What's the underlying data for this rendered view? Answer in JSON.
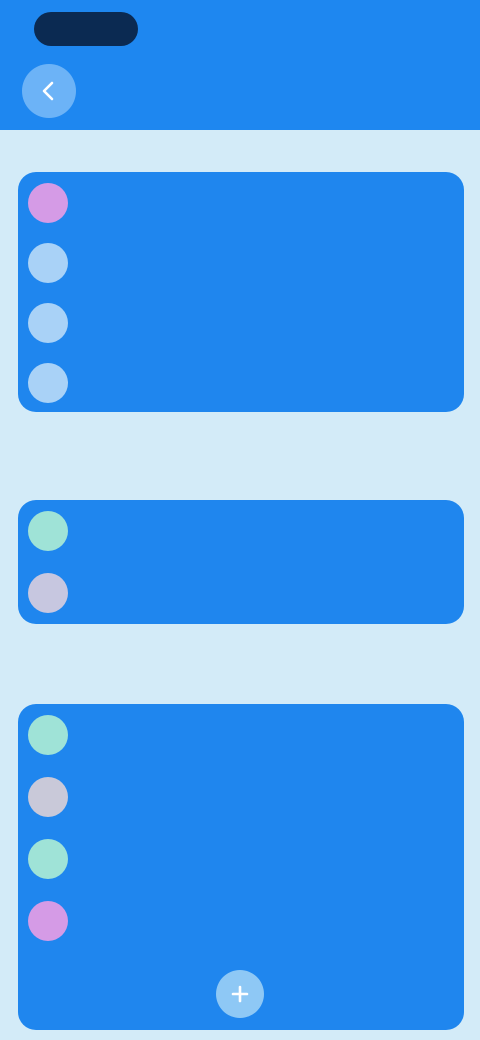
{
  "status_bar": {
    "time": "",
    "indicators": ""
  },
  "header": {
    "title": "",
    "back_icon": "back-arrow-icon"
  },
  "sections": [
    {
      "label": "",
      "rows": [
        {
          "label": "",
          "icon_color": "#d59be6",
          "icon": "circle-icon"
        },
        {
          "label": "",
          "icon_color": "#a9d2f7",
          "icon": "circle-icon"
        },
        {
          "label": "",
          "icon_color": "#a9d2f7",
          "icon": "circle-icon"
        },
        {
          "label": "",
          "icon_color": "#a9d2f7",
          "icon": "circle-icon"
        }
      ]
    },
    {
      "label": "",
      "rows": [
        {
          "label": "",
          "icon_color": "#9fe3d7",
          "icon": "circle-icon"
        },
        {
          "label": "",
          "icon_color": "#c7c7e0",
          "icon": "circle-icon"
        }
      ]
    },
    {
      "label": "",
      "rows": [
        {
          "label": "",
          "icon_color": "#9fe3d7",
          "icon": "circle-icon"
        },
        {
          "label": "",
          "icon_color": "#c9c9d9",
          "icon": "circle-icon"
        },
        {
          "label": "",
          "icon_color": "#9fe3d7",
          "icon": "circle-icon"
        },
        {
          "label": "",
          "icon_color": "#d59be6",
          "icon": "circle-icon"
        }
      ]
    }
  ],
  "fab": {
    "icon": "add-icon"
  },
  "colors": {
    "header": "#1e87f0",
    "card": "#1f86ee",
    "background": "#d3ebf8"
  }
}
